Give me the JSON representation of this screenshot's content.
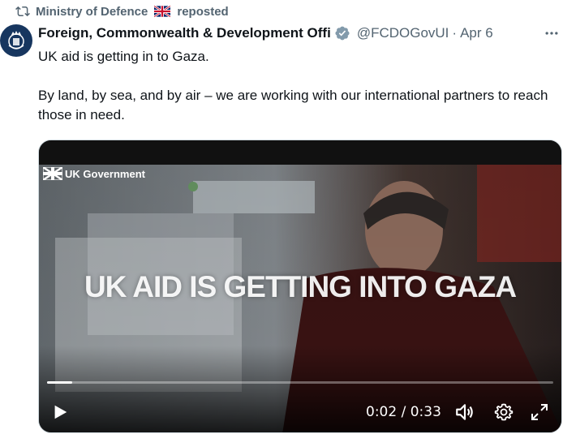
{
  "repost": {
    "account": "Ministry of Defence",
    "flag_icon": "uk-flag-icon",
    "suffix": "reposted"
  },
  "tweet": {
    "author_name": "Foreign, Commonwealth & Development Offi",
    "verified_color": "#829aab",
    "handle": "@FCDOGovUI",
    "separator": "·",
    "date": "Apr 6",
    "text_line1": "UK aid is getting in to Gaza.",
    "text_line2": "By land, by sea, and by air – we are working with our international partners to reach those in need."
  },
  "video": {
    "brand": "UK Government",
    "overlay_title": "UK AID IS GETTING INTO GAZA",
    "current_time": "0:02",
    "time_separator": " / ",
    "duration": "0:33",
    "progress_fraction": 0.05
  },
  "icons": {
    "repost": "repost-icon",
    "verified": "verified-badge-icon",
    "more": "more-options-icon",
    "play": "play-icon",
    "volume": "volume-icon",
    "settings": "settings-gear-icon",
    "fullscreen": "fullscreen-icon"
  }
}
